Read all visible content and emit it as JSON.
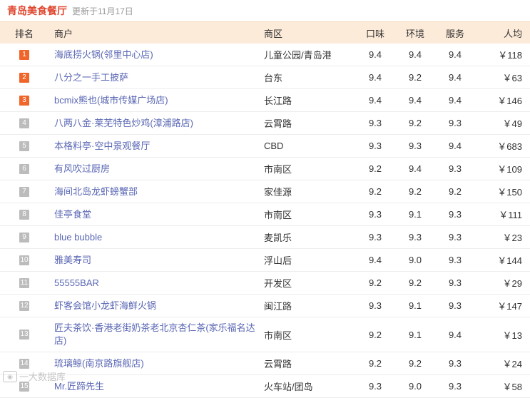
{
  "header": {
    "title": "青岛美食餐厅",
    "updated": "更新于11月17日"
  },
  "columns": {
    "rank": "排名",
    "name": "商户",
    "area": "商区",
    "taste": "口味",
    "env": "环境",
    "service": "服务",
    "avg": "人均"
  },
  "rows": [
    {
      "rank": "1",
      "name": "海底捞火锅(邻里中心店)",
      "area": "儿童公园/青岛港",
      "taste": "9.4",
      "env": "9.4",
      "service": "9.4",
      "avg": "￥118"
    },
    {
      "rank": "2",
      "name": "八分之一手工披萨",
      "area": "台东",
      "taste": "9.4",
      "env": "9.2",
      "service": "9.4",
      "avg": "￥63"
    },
    {
      "rank": "3",
      "name": "bcmix熊也(城市传媒广场店)",
      "area": "长江路",
      "taste": "9.4",
      "env": "9.4",
      "service": "9.4",
      "avg": "￥146"
    },
    {
      "rank": "4",
      "name": "八两八金·莱芜特色炒鸡(漳浦路店)",
      "area": "云霄路",
      "taste": "9.3",
      "env": "9.2",
      "service": "9.3",
      "avg": "￥49"
    },
    {
      "rank": "5",
      "name": "本格料亭·空中景观餐厅",
      "area": "CBD",
      "taste": "9.3",
      "env": "9.3",
      "service": "9.4",
      "avg": "￥683"
    },
    {
      "rank": "6",
      "name": "有风吹过厨房",
      "area": "市南区",
      "taste": "9.2",
      "env": "9.4",
      "service": "9.3",
      "avg": "￥109"
    },
    {
      "rank": "7",
      "name": "海间北岛龙虾螃蟹部",
      "area": "家佳源",
      "taste": "9.2",
      "env": "9.2",
      "service": "9.2",
      "avg": "￥150"
    },
    {
      "rank": "8",
      "name": "佳亭食堂",
      "area": "市南区",
      "taste": "9.3",
      "env": "9.1",
      "service": "9.3",
      "avg": "￥111"
    },
    {
      "rank": "9",
      "name": "blue bubble",
      "area": "麦凯乐",
      "taste": "9.3",
      "env": "9.3",
      "service": "9.3",
      "avg": "￥23"
    },
    {
      "rank": "10",
      "name": "雅美寿司",
      "area": "浮山后",
      "taste": "9.4",
      "env": "9.0",
      "service": "9.3",
      "avg": "￥144"
    },
    {
      "rank": "11",
      "name": "55555BAR",
      "area": "开发区",
      "taste": "9.2",
      "env": "9.2",
      "service": "9.3",
      "avg": "￥29"
    },
    {
      "rank": "12",
      "name": "虾客会馆小龙虾海鲜火锅",
      "area": "闽江路",
      "taste": "9.3",
      "env": "9.1",
      "service": "9.3",
      "avg": "￥147"
    },
    {
      "rank": "13",
      "name": "匠夫茶饮·香港老街奶茶老北京杏仁茶(家乐福名达店)",
      "area": "市南区",
      "taste": "9.2",
      "env": "9.1",
      "service": "9.4",
      "avg": "￥13",
      "tall": true
    },
    {
      "rank": "14",
      "name": "琉璃鲸(南京路旗舰店)",
      "area": "云霄路",
      "taste": "9.2",
      "env": "9.2",
      "service": "9.3",
      "avg": "￥24"
    },
    {
      "rank": "15",
      "name": "Mr.匠蹄先生",
      "area": "火车站/团岛",
      "taste": "9.3",
      "env": "9.0",
      "service": "9.3",
      "avg": "￥58"
    }
  ],
  "watermark": {
    "text": "一大数据库",
    "icon": "camera-icon"
  },
  "colors": {
    "title": "#e0462e",
    "header_bg": "#fdebd9",
    "top_badge": "#f0662a",
    "badge": "#bcbcbc",
    "link": "#5a67b4"
  }
}
